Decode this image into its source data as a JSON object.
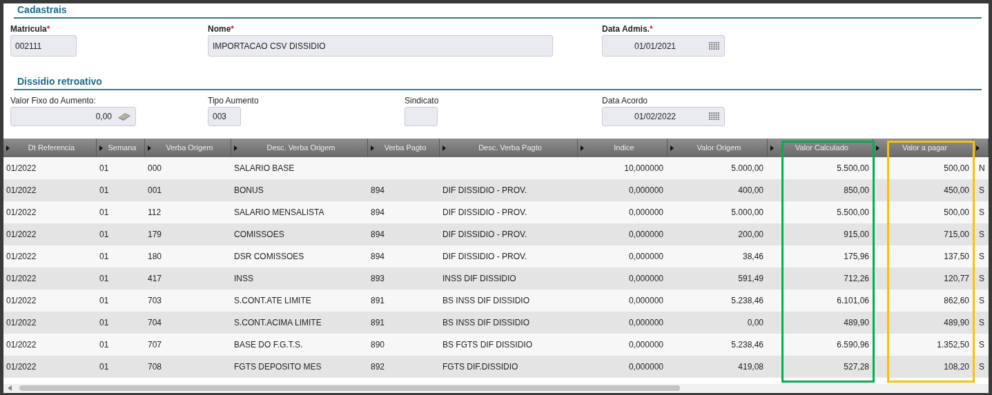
{
  "sections": [
    {
      "title": "Cadastrais",
      "fields": [
        {
          "label": "Matricula",
          "required_mark": "*",
          "kind": "text",
          "value": "002111"
        },
        {
          "label": "Nome",
          "required_mark": "*",
          "kind": "text",
          "value": "IMPORTACAO CSV DISSIDIO"
        },
        {
          "label": "Data Admis.",
          "required_mark": "*",
          "kind": "date",
          "value": "01/01/2021"
        }
      ]
    },
    {
      "title": "Dissidio retroativo",
      "fields": [
        {
          "label": "Valor Fixo do Aumento:",
          "kind": "money",
          "value": "0,00"
        },
        {
          "label": "Tipo Aumento",
          "kind": "text",
          "value": "003"
        },
        {
          "label": "Sindicato",
          "kind": "text"
        },
        {
          "label": "Data Acordo",
          "kind": "date",
          "value": "01/02/2022"
        }
      ]
    }
  ],
  "table": {
    "columns": [
      {
        "label": "Dt Referencia",
        "kind": "text"
      },
      {
        "label": "Semana",
        "kind": "text"
      },
      {
        "label": "Verba Origem",
        "kind": "text"
      },
      {
        "label": "Desc. Verba Origem",
        "kind": "text"
      },
      {
        "label": "Verba Pagto",
        "kind": "text"
      },
      {
        "label": "Desc. Verba Pagto",
        "kind": "text"
      },
      {
        "label": "Indice",
        "kind": "number"
      },
      {
        "label": "Valor Origem",
        "kind": "number"
      },
      {
        "label": "Valor Calculado",
        "kind": "number",
        "color": "#00b050"
      },
      {
        "label": "Valor a pagar",
        "kind": "number",
        "color": "#ffc000"
      },
      {
        "kind": "text"
      }
    ],
    "rows": [
      [
        "01/2022",
        "01",
        "000",
        "SALARIO BASE",
        "",
        "",
        "10,000000",
        "5.000,00",
        "5.500,00",
        "500,00",
        "N"
      ],
      [
        "01/2022",
        "01",
        "001",
        "BONUS",
        "894",
        "DIF DISSIDIO - PROV.",
        "0,000000",
        "400,00",
        "850,00",
        "450,00",
        "S"
      ],
      [
        "01/2022",
        "01",
        "112",
        "SALARIO MENSALISTA",
        "894",
        "DIF DISSIDIO - PROV.",
        "0,000000",
        "5.000,00",
        "5.500,00",
        "500,00",
        "S"
      ],
      [
        "01/2022",
        "01",
        "179",
        "COMISSOES",
        "894",
        "DIF DISSIDIO - PROV.",
        "0,000000",
        "200,00",
        "915,00",
        "715,00",
        "S"
      ],
      [
        "01/2022",
        "01",
        "180",
        "DSR COMISSOES",
        "894",
        "DIF DISSIDIO - PROV.",
        "0,000000",
        "38,46",
        "175,96",
        "137,50",
        "S"
      ],
      [
        "01/2022",
        "01",
        "417",
        "INSS",
        "893",
        "INSS DIF DISSIDIO",
        "0,000000",
        "591,49",
        "712,26",
        "120,77",
        "S"
      ],
      [
        "01/2022",
        "01",
        "703",
        "S.CONT.ATE LIMITE",
        "891",
        "BS INSS DIF DISSIDIO",
        "0,000000",
        "5.238,46",
        "6.101,06",
        "862,60",
        "S"
      ],
      [
        "01/2022",
        "01",
        "704",
        "S.CONT.ACIMA LIMITE",
        "891",
        "BS INSS DIF DISSIDIO",
        "0,000000",
        "0,00",
        "489,90",
        "489,90",
        "S"
      ],
      [
        "01/2022",
        "01",
        "707",
        "BASE DO F.G.T.S.",
        "890",
        "BS FGTS DIF DISSIDIO",
        "0,000000",
        "5.238,46",
        "6.590,96",
        "1.352,50",
        "S"
      ],
      [
        "01/2022",
        "01",
        "708",
        "FGTS DEPOSITO MES",
        "892",
        "FGTS DIF.DISSIDIO",
        "0,000000",
        "419,08",
        "527,28",
        "108,20",
        "S"
      ]
    ]
  }
}
